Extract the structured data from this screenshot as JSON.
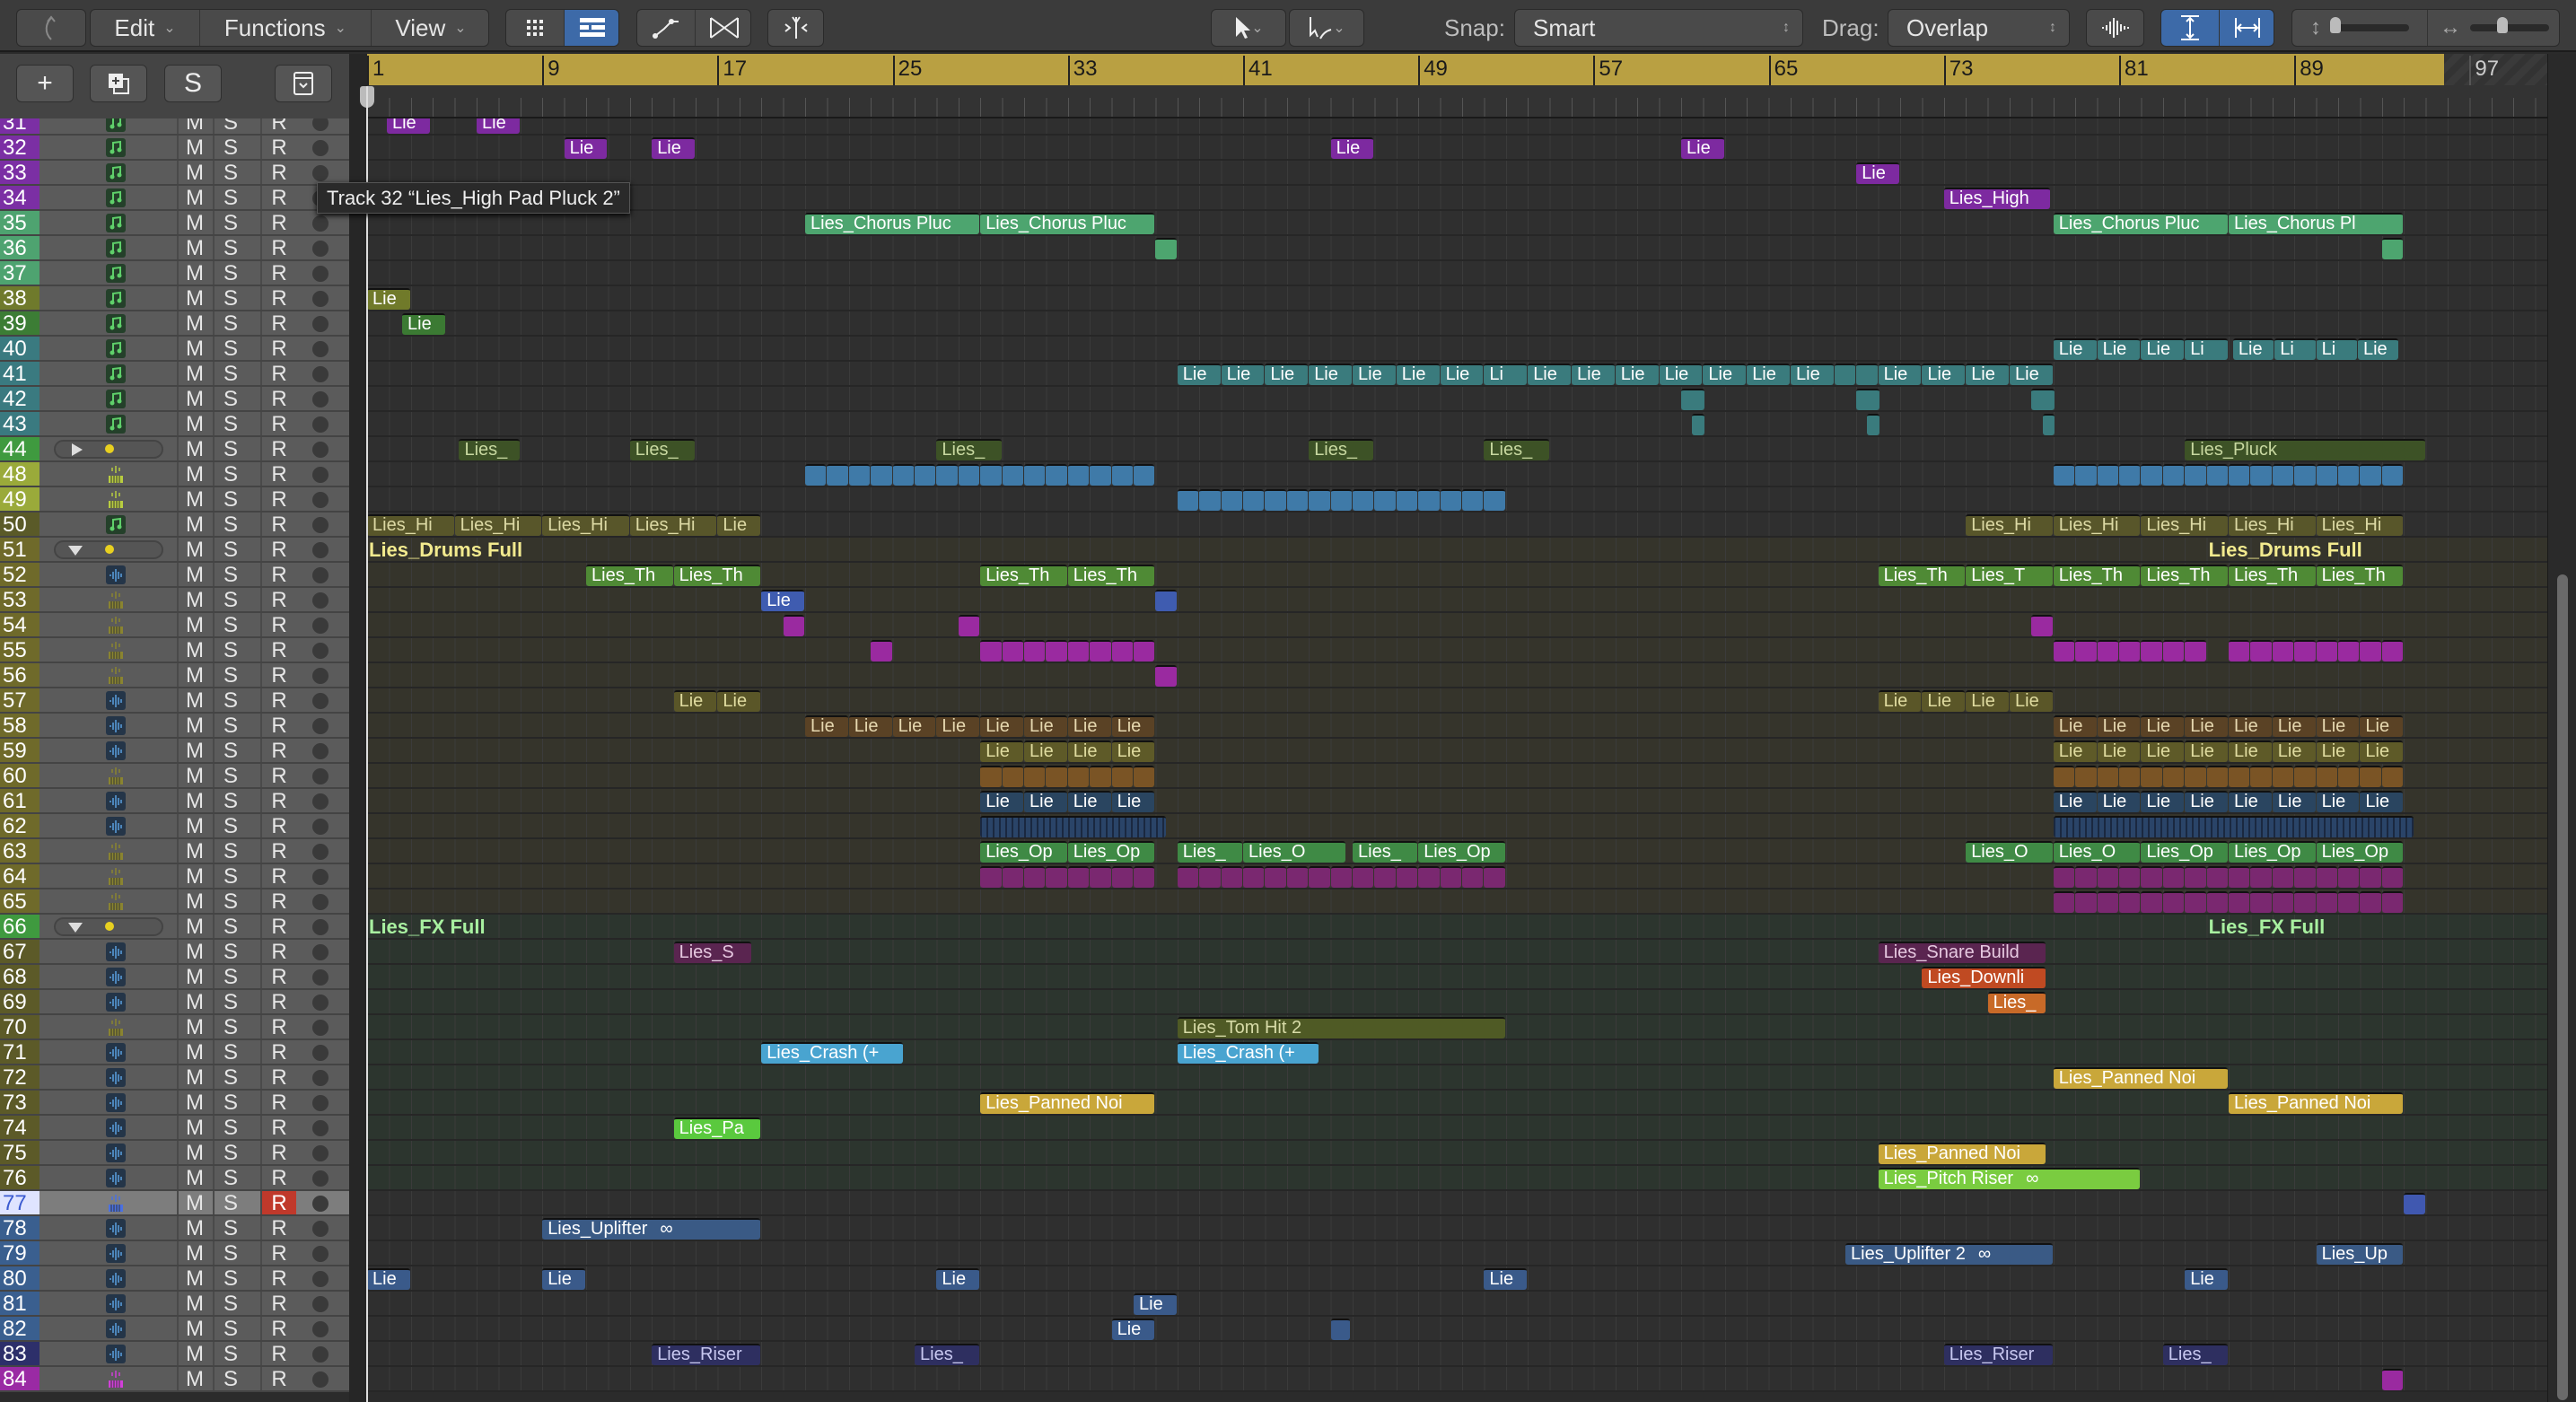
{
  "toolbar": {
    "edit": "Edit",
    "functions": "Functions",
    "view": "View",
    "snap_label": "Snap:",
    "snap_value": "Smart",
    "drag_label": "Drag:",
    "drag_value": "Overlap"
  },
  "header_buttons": {
    "add": "+",
    "solo": "S"
  },
  "tooltip": "Track 32 “Lies_High Pad Pluck 2”",
  "ruler": {
    "bars": [
      1,
      9,
      17,
      25,
      33,
      41,
      49,
      57,
      65,
      73,
      81,
      89,
      97
    ]
  },
  "palette": {
    "purple": "#7d2aa0",
    "chorus": "#4da56f",
    "olive38": "#707a2a",
    "green39": "#3b7a33",
    "teal": "#3a7b7d",
    "dkgreen": "#3d5226",
    "blue48": "#3f7aa8",
    "oliveHi": "#58562a",
    "th": "#4f8a35",
    "blue53": "#3f5cb0",
    "magenta": "#9a2aa0",
    "olive57": "#5a5628",
    "brown58": "#5a4225",
    "olive59": "#5e5a28",
    "brown60": "#7a5425",
    "navy61": "#2a4560",
    "navy62": "#2a4468",
    "green63": "#3f8a45",
    "mag64": "#7a2870",
    "mauve": "#5a2550",
    "orange68": "#c04a22",
    "orange69": "#c86a28",
    "olive70": "#4f5a25",
    "cyan": "#49a4d0",
    "gold": "#c9a73a",
    "lime74": "#5ac93e",
    "lime76": "#7acc40",
    "blue77": "#4058b0",
    "blueUp": "#3a5a85",
    "blue80": "#3a5a8a",
    "riser": "#2e2f60"
  },
  "tracks": [
    {
      "num": "31",
      "color": "#7b2fa4",
      "icon": "midi"
    },
    {
      "num": "32",
      "color": "#7b2fa4",
      "icon": "midi"
    },
    {
      "num": "33",
      "color": "#7b2fa4",
      "icon": "midi"
    },
    {
      "num": "34",
      "color": "#7b2fa4",
      "icon": "midi"
    },
    {
      "num": "35",
      "color": "#4ea370",
      "icon": "midi"
    },
    {
      "num": "36",
      "color": "#4ea370",
      "icon": "midi"
    },
    {
      "num": "37",
      "color": "#4ea370",
      "icon": "midi"
    },
    {
      "num": "38",
      "color": "#6f7a2c",
      "icon": "midi"
    },
    {
      "num": "39",
      "color": "#3c7d35",
      "icon": "midi"
    },
    {
      "num": "40",
      "color": "#3a7a80",
      "icon": "midi"
    },
    {
      "num": "41",
      "color": "#3a7a80",
      "icon": "midi"
    },
    {
      "num": "42",
      "color": "#3a7a80",
      "icon": "midi"
    },
    {
      "num": "43",
      "color": "#3a7a80",
      "icon": "midi"
    },
    {
      "num": "44",
      "color": "#3f9a3f",
      "icon": "folder-closed"
    },
    {
      "num": "48",
      "color": "#9aaa3a",
      "icon": "drum"
    },
    {
      "num": "49",
      "color": "#9aaa3a",
      "icon": "drum"
    },
    {
      "num": "50",
      "color": "#5a5a28",
      "icon": "midi"
    },
    {
      "num": "51",
      "color": "#6f6a2a",
      "icon": "folder-open",
      "group": "drums"
    },
    {
      "num": "52",
      "color": "#6f6a2a",
      "icon": "audio",
      "group": "drums"
    },
    {
      "num": "53",
      "color": "#6f6a2a",
      "icon": "drum-olive",
      "group": "drums"
    },
    {
      "num": "54",
      "color": "#6f6a2a",
      "icon": "drum-olive",
      "group": "drums"
    },
    {
      "num": "55",
      "color": "#6f6a2a",
      "icon": "drum-olive",
      "group": "drums"
    },
    {
      "num": "56",
      "color": "#6f6a2a",
      "icon": "drum-olive",
      "group": "drums"
    },
    {
      "num": "57",
      "color": "#6f6a2a",
      "icon": "audio",
      "group": "drums"
    },
    {
      "num": "58",
      "color": "#6f6a2a",
      "icon": "audio",
      "group": "drums"
    },
    {
      "num": "59",
      "color": "#6f6a2a",
      "icon": "audio",
      "group": "drums"
    },
    {
      "num": "60",
      "color": "#6f6a2a",
      "icon": "drum-olive",
      "group": "drums"
    },
    {
      "num": "61",
      "color": "#6f6a2a",
      "icon": "audio",
      "group": "drums"
    },
    {
      "num": "62",
      "color": "#6f6a2a",
      "icon": "audio",
      "group": "drums"
    },
    {
      "num": "63",
      "color": "#6f6a2a",
      "icon": "drum-olive",
      "group": "drums"
    },
    {
      "num": "64",
      "color": "#6f6a2a",
      "icon": "drum-olive",
      "group": "drums"
    },
    {
      "num": "65",
      "color": "#6f6a2a",
      "icon": "drum-olive",
      "group": "drums"
    },
    {
      "num": "66",
      "color": "#3f9a3f",
      "icon": "folder-open",
      "group": "fx"
    },
    {
      "num": "67",
      "color": "#5c5a28",
      "icon": "audio",
      "group": "fx"
    },
    {
      "num": "68",
      "color": "#5c5a28",
      "icon": "audio",
      "group": "fx"
    },
    {
      "num": "69",
      "color": "#5c5a28",
      "icon": "audio",
      "group": "fx"
    },
    {
      "num": "70",
      "color": "#5c5a28",
      "icon": "drum-olive",
      "group": "fx"
    },
    {
      "num": "71",
      "color": "#5c5a28",
      "icon": "audio",
      "group": "fx"
    },
    {
      "num": "72",
      "color": "#5c5a28",
      "icon": "audio",
      "group": "fx"
    },
    {
      "num": "73",
      "color": "#5c5a28",
      "icon": "audio",
      "group": "fx"
    },
    {
      "num": "74",
      "color": "#5c5a28",
      "icon": "audio",
      "group": "fx"
    },
    {
      "num": "75",
      "color": "#5c5a28",
      "icon": "audio",
      "group": "fx"
    },
    {
      "num": "76",
      "color": "#5c5a28",
      "icon": "audio",
      "group": "fx"
    },
    {
      "num": "77",
      "color": "#dfe4ff",
      "icon": "drum-blue",
      "selected": true,
      "record": true
    },
    {
      "num": "78",
      "color": "#3a5f8f",
      "icon": "audio"
    },
    {
      "num": "79",
      "color": "#3a5f8f",
      "icon": "audio"
    },
    {
      "num": "80",
      "color": "#3a5f8f",
      "icon": "audio"
    },
    {
      "num": "81",
      "color": "#3a5f8f",
      "icon": "audio"
    },
    {
      "num": "82",
      "color": "#3a5f8f",
      "icon": "audio"
    },
    {
      "num": "83",
      "color": "#2d2f6a",
      "icon": "audio"
    },
    {
      "num": "84",
      "color": "#9a2aa4",
      "icon": "drum-magenta"
    }
  ],
  "track_buttons": {
    "mute": "M",
    "solo": "S",
    "record": "R"
  },
  "folder_labels": [
    {
      "track": "51",
      "start": 1,
      "text": "Lies_Drums Full",
      "color": "#f2ea8e"
    },
    {
      "track": "51",
      "start": 85,
      "text": "Lies_Drums Full",
      "color": "#f2ea8e"
    },
    {
      "track": "66",
      "start": 1,
      "text": "Lies_FX Full",
      "color": "#a8f0a0"
    },
    {
      "track": "66",
      "start": 85,
      "text": "Lies_FX Full",
      "color": "#a8f0a0"
    }
  ],
  "regions": [
    {
      "track": "31",
      "start": 1.9,
      "len": 2,
      "label": "Lie",
      "c": "purple"
    },
    {
      "track": "31",
      "start": 6,
      "len": 2,
      "label": "Lie",
      "c": "purple"
    },
    {
      "track": "32",
      "start": 10,
      "len": 2,
      "label": "Lie",
      "c": "purple"
    },
    {
      "track": "32",
      "start": 14,
      "len": 2,
      "label": "Lie",
      "c": "purple"
    },
    {
      "track": "32",
      "start": 45,
      "len": 2,
      "label": "Lie",
      "c": "purple"
    },
    {
      "track": "32",
      "start": 61,
      "len": 2,
      "label": "Lie",
      "c": "purple"
    },
    {
      "track": "33",
      "start": 69,
      "len": 2,
      "label": "Lie",
      "c": "purple"
    },
    {
      "track": "34",
      "start": 73,
      "len": 4.9,
      "label": "Lies_High",
      "c": "purple"
    },
    {
      "track": "35",
      "start": 21,
      "len": 8,
      "label": "Lies_Chorus Pluc",
      "c": "chorus"
    },
    {
      "track": "35",
      "start": 29,
      "len": 8,
      "label": "Lies_Chorus Pluc",
      "c": "chorus"
    },
    {
      "track": "35",
      "start": 78,
      "len": 8,
      "label": "Lies_Chorus Pluc",
      "c": "chorus"
    },
    {
      "track": "35",
      "start": 86,
      "len": 8,
      "label": "Lies_Chorus Pl",
      "c": "chorus"
    },
    {
      "track": "36",
      "start": 37,
      "len": 1,
      "c": "chorus"
    },
    {
      "track": "36",
      "start": 93,
      "len": 1,
      "c": "chorus"
    },
    {
      "track": "38",
      "start": 1,
      "len": 2,
      "label": "Lie",
      "c": "olive38"
    },
    {
      "track": "39",
      "start": 2.6,
      "len": 2,
      "label": "Lie",
      "c": "green39"
    },
    {
      "track": "40",
      "start": 78,
      "len": 2,
      "n": 4,
      "labels": [
        "Lie",
        "Lie",
        "Lie",
        "Li"
      ],
      "c": "teal"
    },
    {
      "track": "40",
      "start": 86.2,
      "len": 1.9,
      "n": 4,
      "labels": [
        "Lie",
        "Li",
        "Li",
        "Lie"
      ],
      "c": "teal"
    },
    {
      "track": "41",
      "start": 38,
      "len": 2,
      "n": 8,
      "labels": [
        "Lie",
        "Lie",
        "Lie",
        "Lie",
        "Lie",
        "Lie",
        "Lie",
        "Li"
      ],
      "c": "teal"
    },
    {
      "track": "41",
      "start": 54,
      "len": 2,
      "n": 7,
      "label": "Lie",
      "c": "teal"
    },
    {
      "track": "41",
      "start": 68,
      "len": 1,
      "n": 2,
      "c": "teal"
    },
    {
      "track": "41",
      "start": 70,
      "len": 2,
      "n": 4,
      "label": "Lie",
      "c": "teal"
    },
    {
      "track": "42",
      "start": 61,
      "len": 1.1,
      "c": "teal"
    },
    {
      "track": "42",
      "start": 69,
      "len": 1.1,
      "c": "teal"
    },
    {
      "track": "42",
      "start": 77,
      "len": 1.1,
      "c": "teal"
    },
    {
      "track": "43",
      "start": 61.5,
      "len": 0.6,
      "c": "teal"
    },
    {
      "track": "43",
      "start": 69.5,
      "len": 0.6,
      "c": "teal"
    },
    {
      "track": "43",
      "start": 77.5,
      "len": 0.6,
      "c": "teal"
    },
    {
      "track": "44",
      "start": 5.2,
      "len": 2.8,
      "label": "Lies_",
      "c": "dkgreen",
      "fg": "#c8d8a0"
    },
    {
      "track": "44",
      "start": 13,
      "len": 3,
      "label": "Lies_",
      "c": "dkgreen",
      "fg": "#c8d8a0"
    },
    {
      "track": "44",
      "start": 27,
      "len": 3,
      "label": "Lies_",
      "c": "dkgreen",
      "fg": "#c8d8a0"
    },
    {
      "track": "44",
      "start": 44,
      "len": 3,
      "label": "Lies_",
      "c": "dkgreen",
      "fg": "#c8d8a0"
    },
    {
      "track": "44",
      "start": 52,
      "len": 3,
      "label": "Lies_",
      "c": "dkgreen",
      "fg": "#c8d8a0"
    },
    {
      "track": "44",
      "start": 84,
      "len": 11,
      "label": "Lies_Pluck",
      "c": "dkgreen",
      "fg": "#c8d8a0"
    },
    {
      "track": "48",
      "start": 21,
      "len": 1,
      "n": 16,
      "c": "blue48"
    },
    {
      "track": "48",
      "start": 78,
      "len": 1,
      "n": 16,
      "c": "blue48"
    },
    {
      "track": "49",
      "start": 38,
      "len": 1,
      "n": 15,
      "c": "blue48"
    },
    {
      "track": "50",
      "start": 1,
      "len": 4,
      "n": 4,
      "label": "Lies_Hi",
      "c": "oliveHi",
      "fg": "#dcd9a4"
    },
    {
      "track": "50",
      "start": 17,
      "len": 2,
      "label": "Lie",
      "c": "oliveHi",
      "fg": "#dcd9a4"
    },
    {
      "track": "50",
      "start": 74,
      "len": 4,
      "n": 5,
      "label": "Lies_Hi",
      "c": "oliveHi",
      "fg": "#dcd9a4"
    },
    {
      "track": "52",
      "start": 11,
      "len": 4,
      "n": 2,
      "label": "Lies_Th",
      "c": "th"
    },
    {
      "track": "52",
      "start": 29,
      "len": 4,
      "n": 2,
      "label": "Lies_Th",
      "c": "th"
    },
    {
      "track": "52",
      "start": 70,
      "len": 4,
      "n": 6,
      "labels": [
        "Lies_Th",
        "Lies_T",
        "Lies_Th",
        "Lies_Th",
        "Lies_Th",
        "Lies_Th"
      ],
      "c": "th"
    },
    {
      "track": "53",
      "start": 19,
      "len": 2,
      "label": "Lie",
      "c": "blue53"
    },
    {
      "track": "53",
      "start": 37,
      "len": 1,
      "c": "blue53"
    },
    {
      "track": "54",
      "start": 20,
      "len": 1,
      "c": "magenta"
    },
    {
      "track": "54",
      "start": 28,
      "len": 1,
      "c": "magenta"
    },
    {
      "track": "54",
      "start": 77,
      "len": 1,
      "c": "magenta"
    },
    {
      "track": "55",
      "start": 24,
      "len": 1,
      "c": "magenta"
    },
    {
      "track": "55",
      "start": 29,
      "len": 1,
      "n": 8,
      "c": "magenta"
    },
    {
      "track": "55",
      "start": 78,
      "len": 1,
      "n": 7,
      "c": "magenta"
    },
    {
      "track": "55",
      "start": 86,
      "len": 1,
      "n": 8,
      "c": "magenta"
    },
    {
      "track": "56",
      "start": 37,
      "len": 1,
      "c": "magenta"
    },
    {
      "track": "57",
      "start": 15,
      "len": 2,
      "n": 2,
      "label": "Lie",
      "c": "olive57",
      "fg": "#e0dca0"
    },
    {
      "track": "57",
      "start": 70,
      "len": 2,
      "n": 4,
      "label": "Lie",
      "c": "olive57",
      "fg": "#e0dca0"
    },
    {
      "track": "58",
      "start": 21,
      "len": 2,
      "n": 8,
      "label": "Lie",
      "c": "brown58",
      "fg": "#e6d8b0"
    },
    {
      "track": "58",
      "start": 78,
      "len": 2,
      "n": 8,
      "label": "Lie",
      "c": "brown58",
      "fg": "#e6d8b0"
    },
    {
      "track": "59",
      "start": 29,
      "len": 2,
      "n": 4,
      "label": "Lie",
      "c": "olive59",
      "fg": "#e0dca0"
    },
    {
      "track": "59",
      "start": 78,
      "len": 2,
      "n": 8,
      "label": "Lie",
      "c": "olive59",
      "fg": "#e0dca0"
    },
    {
      "track": "60",
      "start": 29,
      "len": 1,
      "n": 8,
      "c": "brown60"
    },
    {
      "track": "60",
      "start": 78,
      "len": 1,
      "n": 16,
      "c": "brown60"
    },
    {
      "track": "61",
      "start": 29,
      "len": 2,
      "n": 4,
      "label": "Lie",
      "c": "navy61"
    },
    {
      "track": "61",
      "start": 78,
      "len": 2,
      "n": 8,
      "label": "Lie",
      "c": "navy61"
    },
    {
      "track": "62",
      "start": 29,
      "len": 8.5,
      "c": "navy62",
      "striped": true
    },
    {
      "track": "62",
      "start": 78,
      "len": 16.5,
      "c": "navy62",
      "striped": true
    },
    {
      "track": "63",
      "start": 29,
      "len": 4,
      "n": 2,
      "label": "Lies_Op",
      "c": "green63"
    },
    {
      "track": "63",
      "start": 38,
      "len": 3,
      "label": "Lies_",
      "c": "green63"
    },
    {
      "track": "63",
      "start": 41,
      "len": 4.7,
      "label": "Lies_O",
      "c": "green63"
    },
    {
      "track": "63",
      "start": 46,
      "len": 3,
      "label": "Lies_",
      "c": "green63"
    },
    {
      "track": "63",
      "start": 49,
      "len": 4,
      "label": "Lies_Op",
      "c": "green63"
    },
    {
      "track": "63",
      "start": 74,
      "len": 4,
      "label": "Lies_O",
      "c": "green63"
    },
    {
      "track": "63",
      "start": 78,
      "len": 4,
      "label": "Lies_O",
      "c": "green63"
    },
    {
      "track": "63",
      "start": 82,
      "len": 4,
      "n": 3,
      "label": "Lies_Op",
      "c": "green63"
    },
    {
      "track": "64",
      "start": 29,
      "len": 1,
      "n": 8,
      "c": "mag64"
    },
    {
      "track": "64",
      "start": 38,
      "len": 1,
      "n": 15,
      "c": "mag64"
    },
    {
      "track": "64",
      "start": 78,
      "len": 1,
      "n": 16,
      "c": "mag64"
    },
    {
      "track": "65",
      "start": 78,
      "len": 1,
      "n": 16,
      "c": "mag64"
    },
    {
      "track": "67",
      "start": 15,
      "len": 3.6,
      "label": "Lies_S",
      "c": "mauve",
      "fg": "#e6c8e0"
    },
    {
      "track": "67",
      "start": 70,
      "len": 7.7,
      "label": "Lies_Snare Build",
      "c": "mauve",
      "fg": "#e6c8e0"
    },
    {
      "track": "68",
      "start": 72,
      "len": 5.7,
      "label": "Lies_Downli",
      "c": "orange68"
    },
    {
      "track": "69",
      "start": 75,
      "len": 2.7,
      "label": "Lies_",
      "c": "orange69"
    },
    {
      "track": "70",
      "start": 38,
      "len": 15,
      "label": "Lies_Tom Hit 2",
      "c": "olive70",
      "fg": "#d8dca8"
    },
    {
      "track": "71",
      "start": 19,
      "len": 6.5,
      "label": "Lies_Crash (+",
      "c": "cyan"
    },
    {
      "track": "71",
      "start": 38,
      "len": 6.5,
      "label": "Lies_Crash (+",
      "c": "cyan"
    },
    {
      "track": "72",
      "start": 78,
      "len": 8,
      "label": "Lies_Panned Noi",
      "c": "gold"
    },
    {
      "track": "73",
      "start": 29,
      "len": 8,
      "label": "Lies_Panned Noi",
      "c": "gold"
    },
    {
      "track": "73",
      "start": 86,
      "len": 8,
      "label": "Lies_Panned Noi",
      "c": "gold"
    },
    {
      "track": "74",
      "start": 15,
      "len": 4,
      "label": "Lies_Pa",
      "c": "lime74"
    },
    {
      "track": "75",
      "start": 70,
      "len": 7.7,
      "label": "Lies_Panned Noi",
      "c": "gold"
    },
    {
      "track": "76",
      "start": 70,
      "len": 12,
      "label": "Lies_Pitch Riser",
      "c": "lime76",
      "loop": true
    },
    {
      "track": "77",
      "start": 94,
      "len": 1,
      "c": "blue77"
    },
    {
      "track": "78",
      "start": 9,
      "len": 10,
      "label": "Lies_Uplifter",
      "c": "blueUp",
      "loop": true
    },
    {
      "track": "79",
      "start": 68.5,
      "len": 9.5,
      "label": "Lies_Uplifter 2",
      "c": "blueUp",
      "loop": true
    },
    {
      "track": "79",
      "start": 90,
      "len": 4,
      "label": "Lies_Up",
      "c": "blueUp"
    },
    {
      "track": "80",
      "start": 1,
      "len": 2,
      "label": "Lie",
      "c": "blue80"
    },
    {
      "track": "80",
      "start": 9,
      "len": 2,
      "label": "Lie",
      "c": "blue80"
    },
    {
      "track": "80",
      "start": 27,
      "len": 2,
      "label": "Lie",
      "c": "blue80"
    },
    {
      "track": "80",
      "start": 52,
      "len": 2,
      "label": "Lie",
      "c": "blue80"
    },
    {
      "track": "80",
      "start": 84,
      "len": 2,
      "label": "Lie",
      "c": "blue80"
    },
    {
      "track": "81",
      "start": 36,
      "len": 2,
      "label": "Lie",
      "c": "blue80"
    },
    {
      "track": "82",
      "start": 35,
      "len": 2,
      "label": "Lie",
      "c": "blue80"
    },
    {
      "track": "82",
      "start": 45,
      "len": 0.9,
      "c": "blue80"
    },
    {
      "track": "83",
      "start": 14,
      "len": 5,
      "label": "Lies_Riser",
      "c": "riser",
      "fg": "#c8c8f0"
    },
    {
      "track": "83",
      "start": 26,
      "len": 3,
      "label": "Lies_",
      "c": "riser",
      "fg": "#c8c8f0"
    },
    {
      "track": "83",
      "start": 73,
      "len": 5,
      "label": "Lies_Riser",
      "c": "riser",
      "fg": "#c8c8f0"
    },
    {
      "track": "83",
      "start": 83,
      "len": 3,
      "label": "Lies_",
      "c": "riser",
      "fg": "#c8c8f0"
    },
    {
      "track": "84",
      "start": 93,
      "len": 1,
      "c": "magenta"
    }
  ]
}
